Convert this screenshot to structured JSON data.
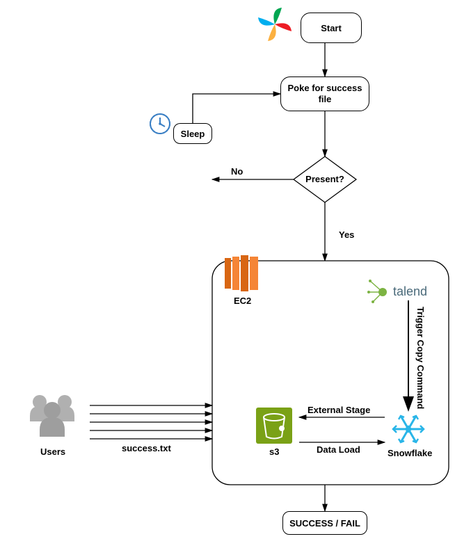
{
  "nodes": {
    "start": "Start",
    "poke": "Poke for success file",
    "sleep": "Sleep",
    "decision": "Present?",
    "no": "No",
    "yes": "Yes",
    "ec2": "EC2",
    "talend": "talend",
    "trigger": "Trigger Copy Command",
    "external_stage": "External Stage",
    "data_load": "Data Load",
    "s3": "s3",
    "snowflake": "Snowflake",
    "users": "Users",
    "successtxt": "success.txt",
    "result": "SUCCESS / FAIL"
  }
}
